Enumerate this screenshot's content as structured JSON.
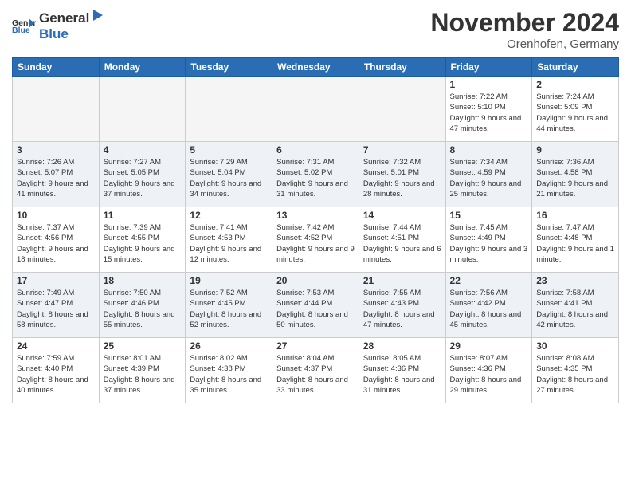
{
  "header": {
    "logo_general": "General",
    "logo_blue": "Blue",
    "title": "November 2024",
    "location": "Orenhofen, Germany"
  },
  "weekdays": [
    "Sunday",
    "Monday",
    "Tuesday",
    "Wednesday",
    "Thursday",
    "Friday",
    "Saturday"
  ],
  "weeks": [
    [
      {
        "day": "",
        "info": ""
      },
      {
        "day": "",
        "info": ""
      },
      {
        "day": "",
        "info": ""
      },
      {
        "day": "",
        "info": ""
      },
      {
        "day": "",
        "info": ""
      },
      {
        "day": "1",
        "info": "Sunrise: 7:22 AM\nSunset: 5:10 PM\nDaylight: 9 hours and 47 minutes."
      },
      {
        "day": "2",
        "info": "Sunrise: 7:24 AM\nSunset: 5:09 PM\nDaylight: 9 hours and 44 minutes."
      }
    ],
    [
      {
        "day": "3",
        "info": "Sunrise: 7:26 AM\nSunset: 5:07 PM\nDaylight: 9 hours and 41 minutes."
      },
      {
        "day": "4",
        "info": "Sunrise: 7:27 AM\nSunset: 5:05 PM\nDaylight: 9 hours and 37 minutes."
      },
      {
        "day": "5",
        "info": "Sunrise: 7:29 AM\nSunset: 5:04 PM\nDaylight: 9 hours and 34 minutes."
      },
      {
        "day": "6",
        "info": "Sunrise: 7:31 AM\nSunset: 5:02 PM\nDaylight: 9 hours and 31 minutes."
      },
      {
        "day": "7",
        "info": "Sunrise: 7:32 AM\nSunset: 5:01 PM\nDaylight: 9 hours and 28 minutes."
      },
      {
        "day": "8",
        "info": "Sunrise: 7:34 AM\nSunset: 4:59 PM\nDaylight: 9 hours and 25 minutes."
      },
      {
        "day": "9",
        "info": "Sunrise: 7:36 AM\nSunset: 4:58 PM\nDaylight: 9 hours and 21 minutes."
      }
    ],
    [
      {
        "day": "10",
        "info": "Sunrise: 7:37 AM\nSunset: 4:56 PM\nDaylight: 9 hours and 18 minutes."
      },
      {
        "day": "11",
        "info": "Sunrise: 7:39 AM\nSunset: 4:55 PM\nDaylight: 9 hours and 15 minutes."
      },
      {
        "day": "12",
        "info": "Sunrise: 7:41 AM\nSunset: 4:53 PM\nDaylight: 9 hours and 12 minutes."
      },
      {
        "day": "13",
        "info": "Sunrise: 7:42 AM\nSunset: 4:52 PM\nDaylight: 9 hours and 9 minutes."
      },
      {
        "day": "14",
        "info": "Sunrise: 7:44 AM\nSunset: 4:51 PM\nDaylight: 9 hours and 6 minutes."
      },
      {
        "day": "15",
        "info": "Sunrise: 7:45 AM\nSunset: 4:49 PM\nDaylight: 9 hours and 3 minutes."
      },
      {
        "day": "16",
        "info": "Sunrise: 7:47 AM\nSunset: 4:48 PM\nDaylight: 9 hours and 1 minute."
      }
    ],
    [
      {
        "day": "17",
        "info": "Sunrise: 7:49 AM\nSunset: 4:47 PM\nDaylight: 8 hours and 58 minutes."
      },
      {
        "day": "18",
        "info": "Sunrise: 7:50 AM\nSunset: 4:46 PM\nDaylight: 8 hours and 55 minutes."
      },
      {
        "day": "19",
        "info": "Sunrise: 7:52 AM\nSunset: 4:45 PM\nDaylight: 8 hours and 52 minutes."
      },
      {
        "day": "20",
        "info": "Sunrise: 7:53 AM\nSunset: 4:44 PM\nDaylight: 8 hours and 50 minutes."
      },
      {
        "day": "21",
        "info": "Sunrise: 7:55 AM\nSunset: 4:43 PM\nDaylight: 8 hours and 47 minutes."
      },
      {
        "day": "22",
        "info": "Sunrise: 7:56 AM\nSunset: 4:42 PM\nDaylight: 8 hours and 45 minutes."
      },
      {
        "day": "23",
        "info": "Sunrise: 7:58 AM\nSunset: 4:41 PM\nDaylight: 8 hours and 42 minutes."
      }
    ],
    [
      {
        "day": "24",
        "info": "Sunrise: 7:59 AM\nSunset: 4:40 PM\nDaylight: 8 hours and 40 minutes."
      },
      {
        "day": "25",
        "info": "Sunrise: 8:01 AM\nSunset: 4:39 PM\nDaylight: 8 hours and 37 minutes."
      },
      {
        "day": "26",
        "info": "Sunrise: 8:02 AM\nSunset: 4:38 PM\nDaylight: 8 hours and 35 minutes."
      },
      {
        "day": "27",
        "info": "Sunrise: 8:04 AM\nSunset: 4:37 PM\nDaylight: 8 hours and 33 minutes."
      },
      {
        "day": "28",
        "info": "Sunrise: 8:05 AM\nSunset: 4:36 PM\nDaylight: 8 hours and 31 minutes."
      },
      {
        "day": "29",
        "info": "Sunrise: 8:07 AM\nSunset: 4:36 PM\nDaylight: 8 hours and 29 minutes."
      },
      {
        "day": "30",
        "info": "Sunrise: 8:08 AM\nSunset: 4:35 PM\nDaylight: 8 hours and 27 minutes."
      }
    ]
  ]
}
